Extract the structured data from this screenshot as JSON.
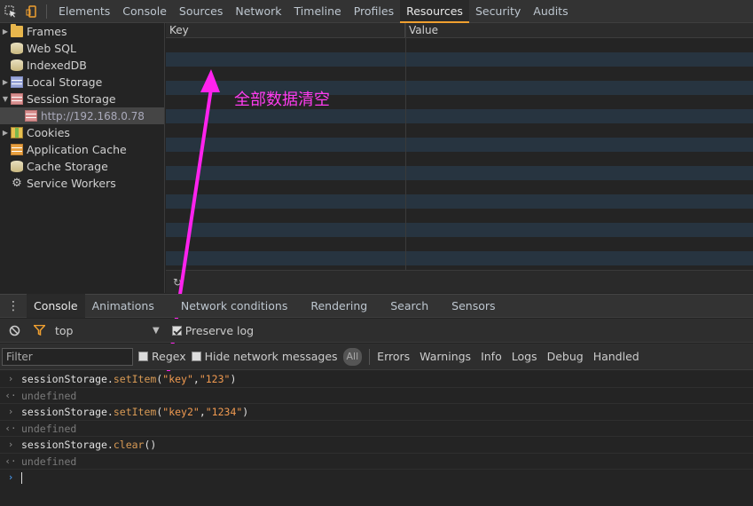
{
  "toolbar": {
    "tabs": [
      "Elements",
      "Console",
      "Sources",
      "Network",
      "Timeline",
      "Profiles",
      "Resources",
      "Security",
      "Audits"
    ],
    "active_tab": "Resources"
  },
  "sidebar": {
    "items": [
      {
        "label": "Frames",
        "icon": "folder-icon"
      },
      {
        "label": "Web SQL",
        "icon": "database-icon"
      },
      {
        "label": "IndexedDB",
        "icon": "database-icon"
      },
      {
        "label": "Local Storage",
        "icon": "storage-grid-icon"
      },
      {
        "label": "Session Storage",
        "icon": "storage-grid-icon"
      },
      {
        "label": "http://192.168.0.78",
        "icon": "storage-grid-icon"
      },
      {
        "label": "Cookies",
        "icon": "cookie-icon"
      },
      {
        "label": "Application Cache",
        "icon": "cache-icon"
      },
      {
        "label": "Cache Storage",
        "icon": "database-icon"
      },
      {
        "label": "Service Workers",
        "icon": "gear-icon"
      }
    ]
  },
  "storage_table": {
    "col_key": "Key",
    "col_value": "Value"
  },
  "annotation": {
    "text": "全部数据清空",
    "color": "#ff3cf0"
  },
  "drawer": {
    "tabs": [
      "Console",
      "Animations",
      "Network conditions",
      "Rendering",
      "Search",
      "Sensors"
    ],
    "active_tab": "Console"
  },
  "console_toolbar": {
    "context": "top",
    "preserve_log": "Preserve log",
    "filter_placeholder": "Filter",
    "regex": "Regex",
    "hide_network": "Hide network messages",
    "all": "All",
    "levels": [
      "Errors",
      "Warnings",
      "Info",
      "Logs",
      "Debug",
      "Handled"
    ]
  },
  "console_log": {
    "line1": {
      "obj": "sessionStorage.",
      "method": "setItem",
      "args_open": "(",
      "a1": "\"key\"",
      "comma": ",",
      "a2": "\"123\"",
      "close": ")"
    },
    "out1": "undefined",
    "line2": {
      "obj": "sessionStorage.",
      "method": "setItem",
      "args_open": "(",
      "a1": "\"key2\"",
      "comma": ",",
      "a2": "\"1234\"",
      "close": ")"
    },
    "out2": "undefined",
    "line3": {
      "obj": "sessionStorage.",
      "method": "clear",
      "args": "()"
    },
    "out3": "undefined"
  }
}
